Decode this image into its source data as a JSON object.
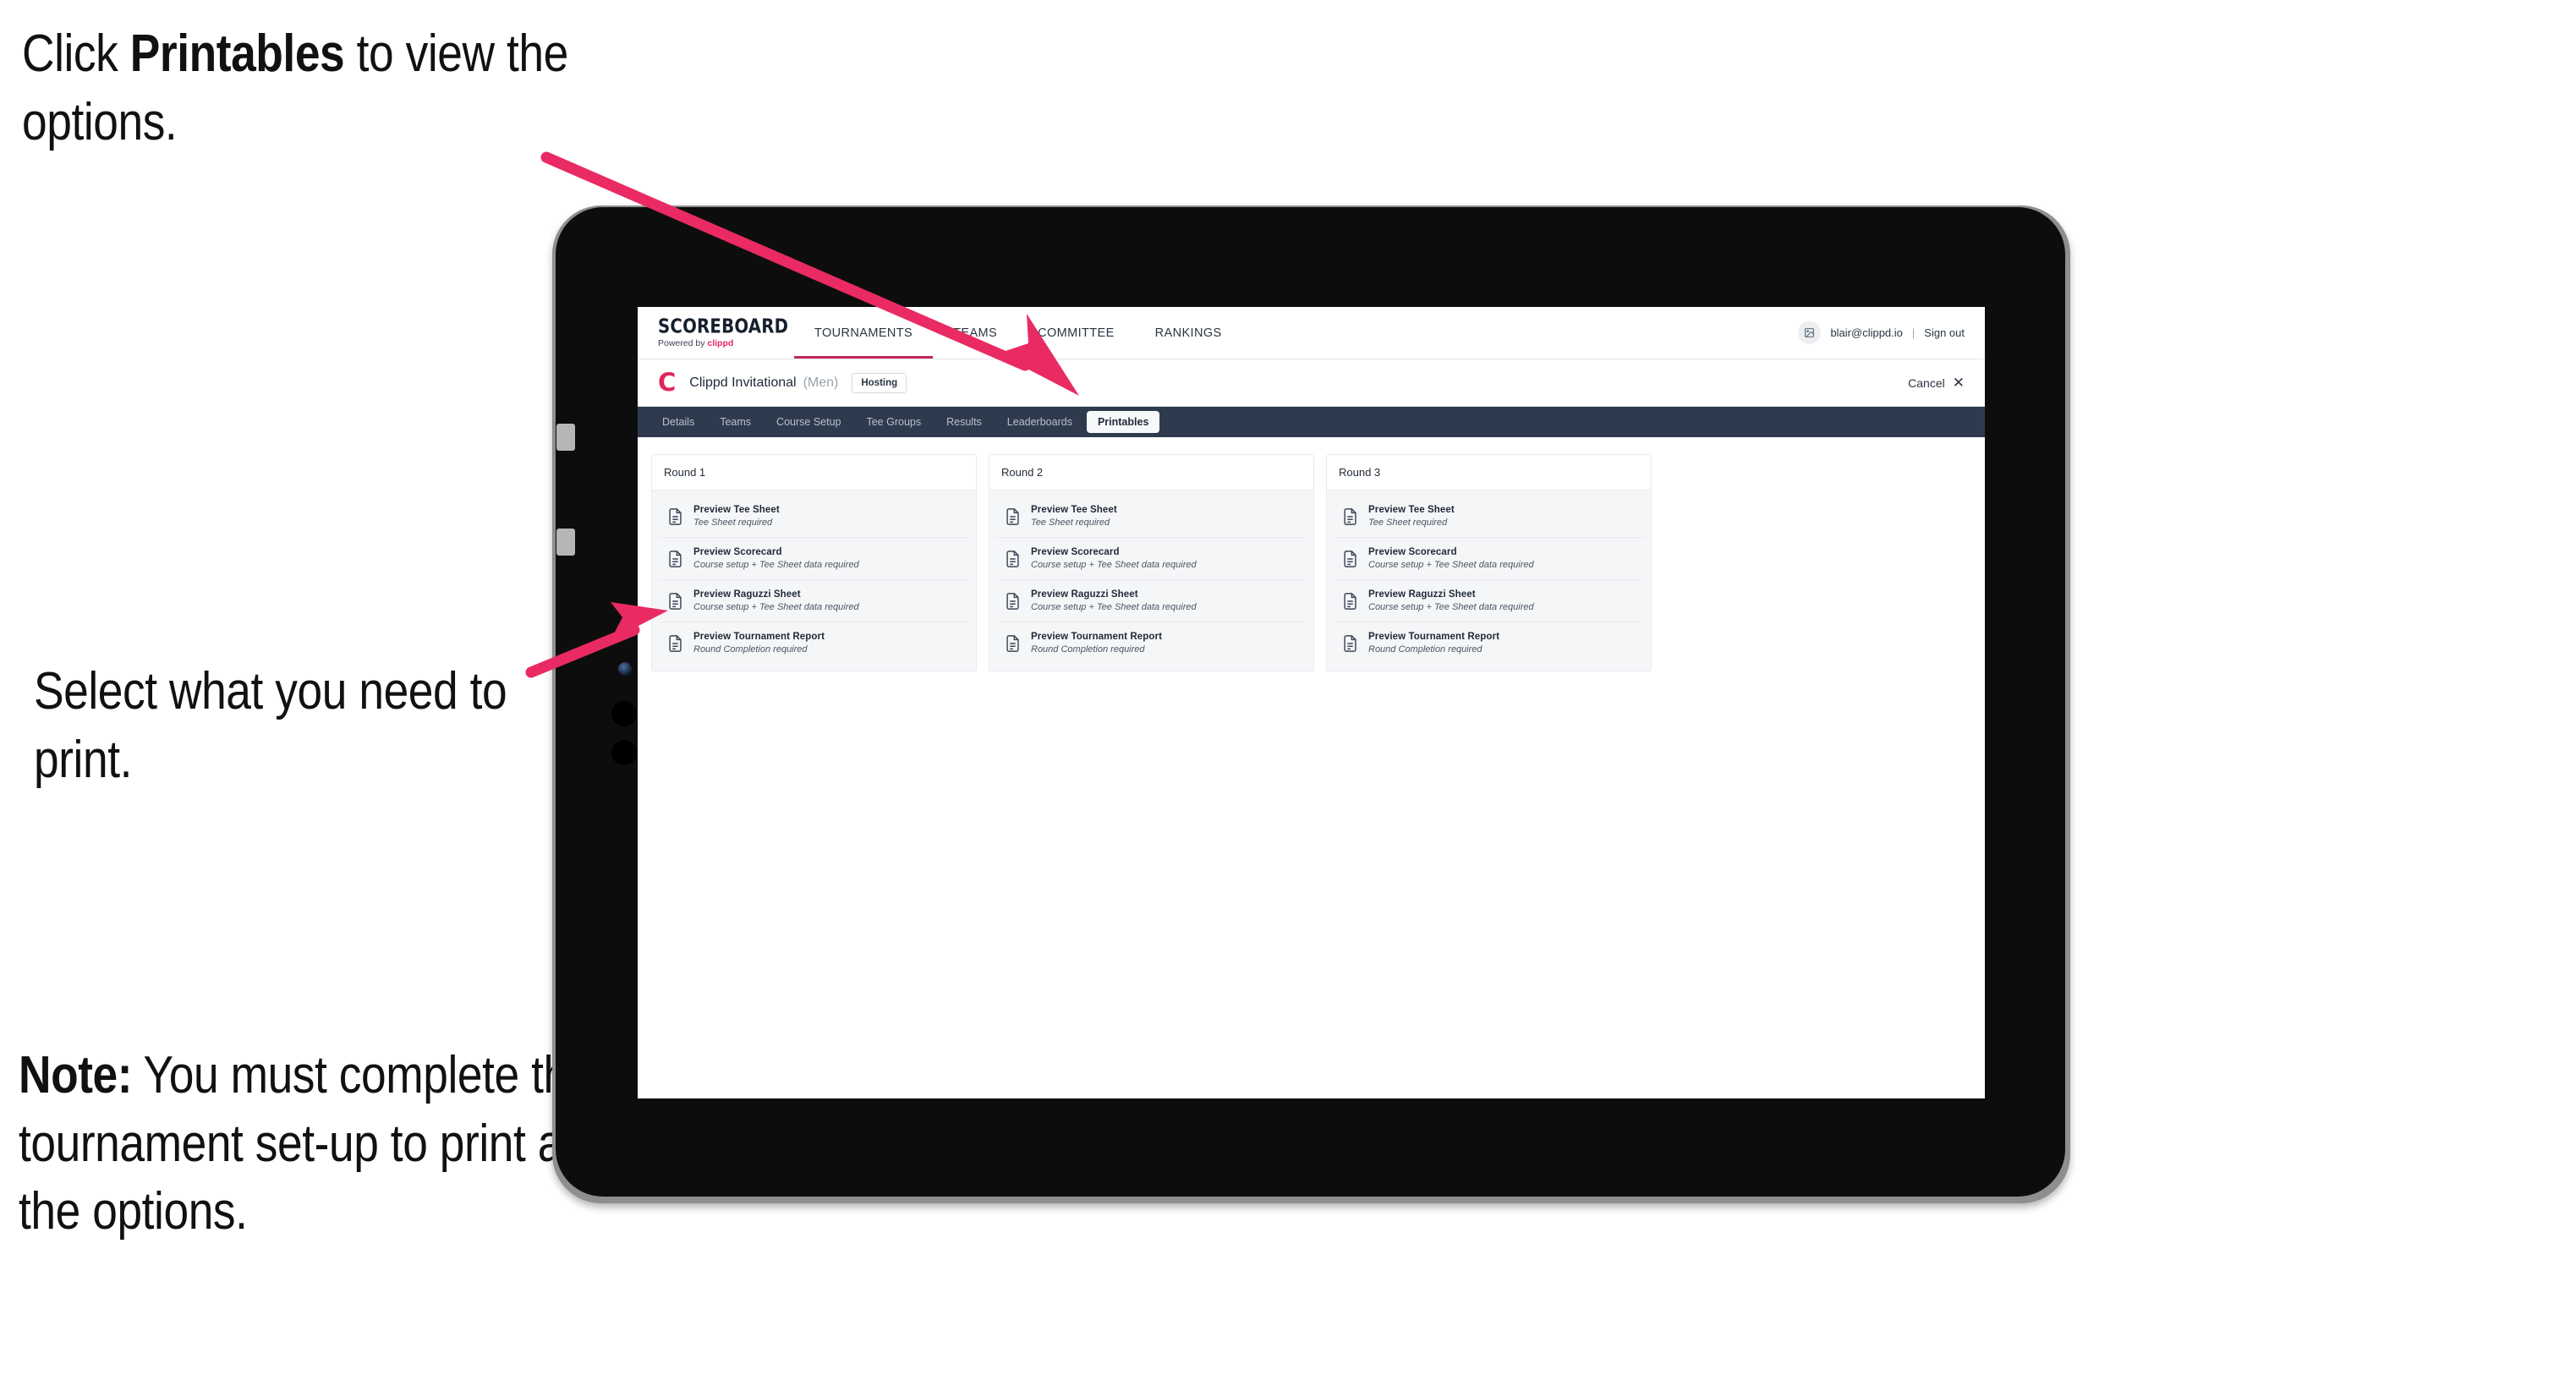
{
  "annotations": {
    "click_prefix": "Click ",
    "click_bold": "Printables",
    "click_suffix": " to view the options.",
    "select": "Select what you need to print.",
    "note_bold": "Note:",
    "note_rest": " You must complete the tournament set-up to print all the options.",
    "arrow_color": "#ea2a62"
  },
  "app": {
    "brand": {
      "title": "SCOREBOARD",
      "sub_prefix": "Powered by ",
      "sub_brand": "clippd"
    },
    "topnav": [
      {
        "label": "TOURNAMENTS",
        "active": true
      },
      {
        "label": "TEAMS",
        "active": false
      },
      {
        "label": "COMMITTEE",
        "active": false
      },
      {
        "label": "RANKINGS",
        "active": false
      }
    ],
    "account": {
      "avatar_icon": "user-avatar-icon",
      "email": "blair@clippd.io",
      "separator": "|",
      "sign_out": "Sign out"
    },
    "tournament": {
      "logo_letter": "C",
      "name": "Clippd Invitational",
      "gender": "(Men)",
      "status": "Hosting",
      "cancel_label": "Cancel",
      "cancel_icon": "close-icon"
    },
    "tabs": [
      {
        "label": "Details",
        "active": false
      },
      {
        "label": "Teams",
        "active": false
      },
      {
        "label": "Course Setup",
        "active": false
      },
      {
        "label": "Tee Groups",
        "active": false
      },
      {
        "label": "Results",
        "active": false
      },
      {
        "label": "Leaderboards",
        "active": false
      },
      {
        "label": "Printables",
        "active": true
      }
    ],
    "rounds": [
      {
        "title": "Round 1",
        "items": [
          {
            "title": "Preview Tee Sheet",
            "sub": "Tee Sheet required"
          },
          {
            "title": "Preview Scorecard",
            "sub": "Course setup + Tee Sheet data required"
          },
          {
            "title": "Preview Raguzzi Sheet",
            "sub": "Course setup + Tee Sheet data required"
          },
          {
            "title": "Preview Tournament Report",
            "sub": "Round Completion required"
          }
        ]
      },
      {
        "title": "Round 2",
        "items": [
          {
            "title": "Preview Tee Sheet",
            "sub": "Tee Sheet required"
          },
          {
            "title": "Preview Scorecard",
            "sub": "Course setup + Tee Sheet data required"
          },
          {
            "title": "Preview Raguzzi Sheet",
            "sub": "Course setup + Tee Sheet data required"
          },
          {
            "title": "Preview Tournament Report",
            "sub": "Round Completion required"
          }
        ]
      },
      {
        "title": "Round 3",
        "items": [
          {
            "title": "Preview Tee Sheet",
            "sub": "Tee Sheet required"
          },
          {
            "title": "Preview Scorecard",
            "sub": "Course setup + Tee Sheet data required"
          },
          {
            "title": "Preview Raguzzi Sheet",
            "sub": "Course setup + Tee Sheet data required"
          },
          {
            "title": "Preview Tournament Report",
            "sub": "Round Completion required"
          }
        ]
      }
    ]
  },
  "colors": {
    "accent_pink": "#e2255c",
    "tabstrip_dark": "#2e3a4e",
    "nav_underline": "#c0295a"
  }
}
